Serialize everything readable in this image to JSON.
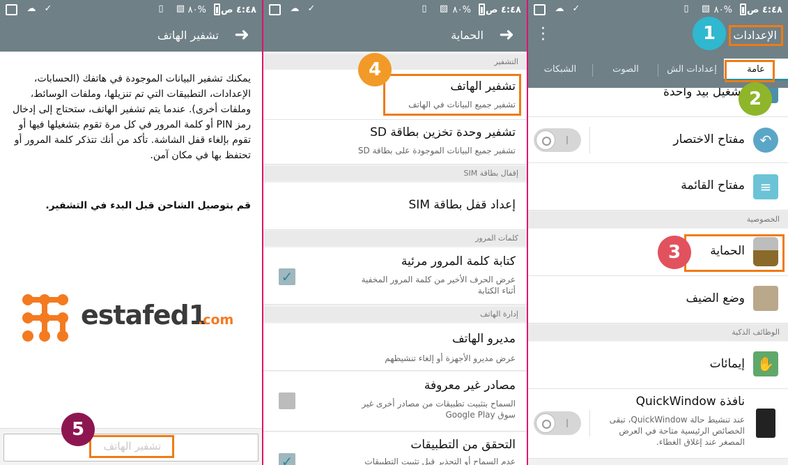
{
  "status_bar": {
    "time": "٤:٤٨ ص",
    "battery": "%٨٠"
  },
  "left": {
    "title": "تشفير الهاتف",
    "body": "يمكنك تشفير البيانات الموجودة في هاتفك (الحسابات، الإعدادات، التطبيقات التي تم تنزيلها، وملفات الوسائط، وملفات أخرى). عندما يتم تشفير الهاتف، ستحتاج إلى إدخال رمز PIN أو كلمة المرور في كل مرة تقوم بتشغيلها فيها أو تقوم بإلغاء قفل الشاشة. تأكد من أنك تتذكر كلمة المرور أو تحتفظ بها في مكان آمن.",
    "note": "قم بتوصيل الشاحن قبل البدء في التشفير.",
    "watermark": "estafed1",
    "watermark_tld": ".com",
    "encrypt_button": "تشفير الهاتف",
    "step": "5"
  },
  "middle": {
    "title": "الحماية",
    "sections": {
      "encryption": "التشفير",
      "sim_lock": "إقفال بطاقة SIM",
      "passwords": "كلمات المرور",
      "device_admin": "إدارة الهاتف"
    },
    "items": {
      "encrypt_phone": {
        "title": "تشفير الهاتف",
        "sub": "تشفير جميع البيانات في الهاتف"
      },
      "encrypt_sd": {
        "title": "تشفير وحدة تخزين بطاقة SD",
        "sub": "تشفير جميع البيانات الموجودة على بطاقة SD"
      },
      "sim_lock": {
        "title": "إعداد قفل بطاقة SIM"
      },
      "visible_password": {
        "title": "كتابة كلمة المرور مرئية",
        "sub": "عرض الحرف الأخير من كلمة المرور المخفية أثناء الكتابة"
      },
      "device_admins": {
        "title": "مديرو الهاتف",
        "sub": "عرض مديرو الأجهزة أو إلغاء تنشيطهم"
      },
      "unknown_sources": {
        "title": "مصادر غير معروفة",
        "sub": "السماح بتثبيت تطبيقات من مصادر أخرى غير سوق Google Play"
      },
      "verify_apps": {
        "title": "التحقق من التطبيقات",
        "sub": "عدم السماح أو التحذير قبل تثبيت التطبيقات"
      }
    },
    "step": "4"
  },
  "right": {
    "title": "الإعدادات",
    "tabs": [
      "عامة",
      "إعدادات الش",
      "الصوت",
      "الشبكات"
    ],
    "sections": {
      "privacy": "الخصوصية",
      "smart": "الوظائف الذكية"
    },
    "items": {
      "one_hand": "تشغيل بيد واحدة",
      "shortcut_key": "مفتاح الاختصار",
      "menu_key": "مفتاح القائمة",
      "security": "الحماية",
      "guest_mode": "وضع الضيف",
      "gestures": "إيمائات",
      "quickwindow": {
        "title": "نافذة QuickWindow",
        "sub": "عند تنشيط حالة QuickWindow، تبقى الخصائص الرئيسية متاحة في العرض المصغر عند إغلاق الغطاء."
      }
    },
    "steps": [
      "1",
      "2",
      "3"
    ]
  },
  "colors": {
    "bar": "#6f8087",
    "accent": "#f07b14",
    "teal": "#2a8ea4"
  }
}
